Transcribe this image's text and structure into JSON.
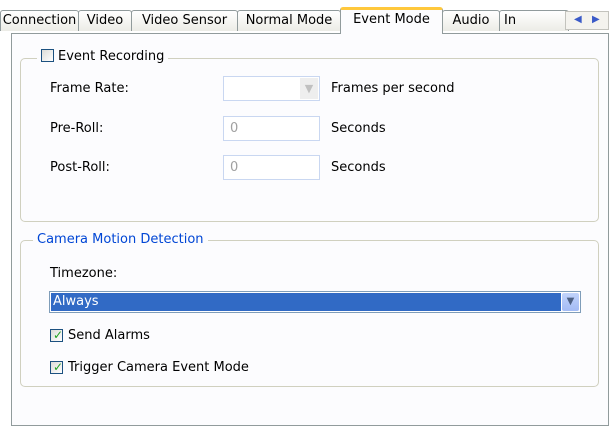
{
  "tabs": [
    {
      "label": "Connection",
      "active": false
    },
    {
      "label": "Video",
      "active": false
    },
    {
      "label": "Video Sensor",
      "active": false
    },
    {
      "label": "Normal Mode",
      "active": false
    },
    {
      "label": "Event Mode",
      "active": true
    },
    {
      "label": "Audio",
      "active": false
    },
    {
      "label": "In",
      "active": false
    }
  ],
  "tab_scroll": {
    "left": "◀",
    "right": "▶"
  },
  "event_recording": {
    "checkbox_label": "Event Recording",
    "checked": false,
    "frame_rate": {
      "label": "Frame Rate:",
      "value": "",
      "unit": "Frames per second"
    },
    "pre_roll": {
      "label": "Pre-Roll:",
      "value": "0",
      "unit": "Seconds"
    },
    "post_roll": {
      "label": "Post-Roll:",
      "value": "0",
      "unit": "Seconds"
    }
  },
  "motion_detection": {
    "legend": "Camera Motion Detection",
    "timezone_label": "Timezone:",
    "timezone_value": "Always",
    "send_alarms": {
      "label": "Send Alarms",
      "checked": true
    },
    "trigger_event_mode": {
      "label": "Trigger Camera Event Mode",
      "checked": true
    }
  },
  "colors": {
    "legend_blue": "#0046d5",
    "selection": "#316ac5",
    "tab_highlight": "#ffc83c"
  }
}
